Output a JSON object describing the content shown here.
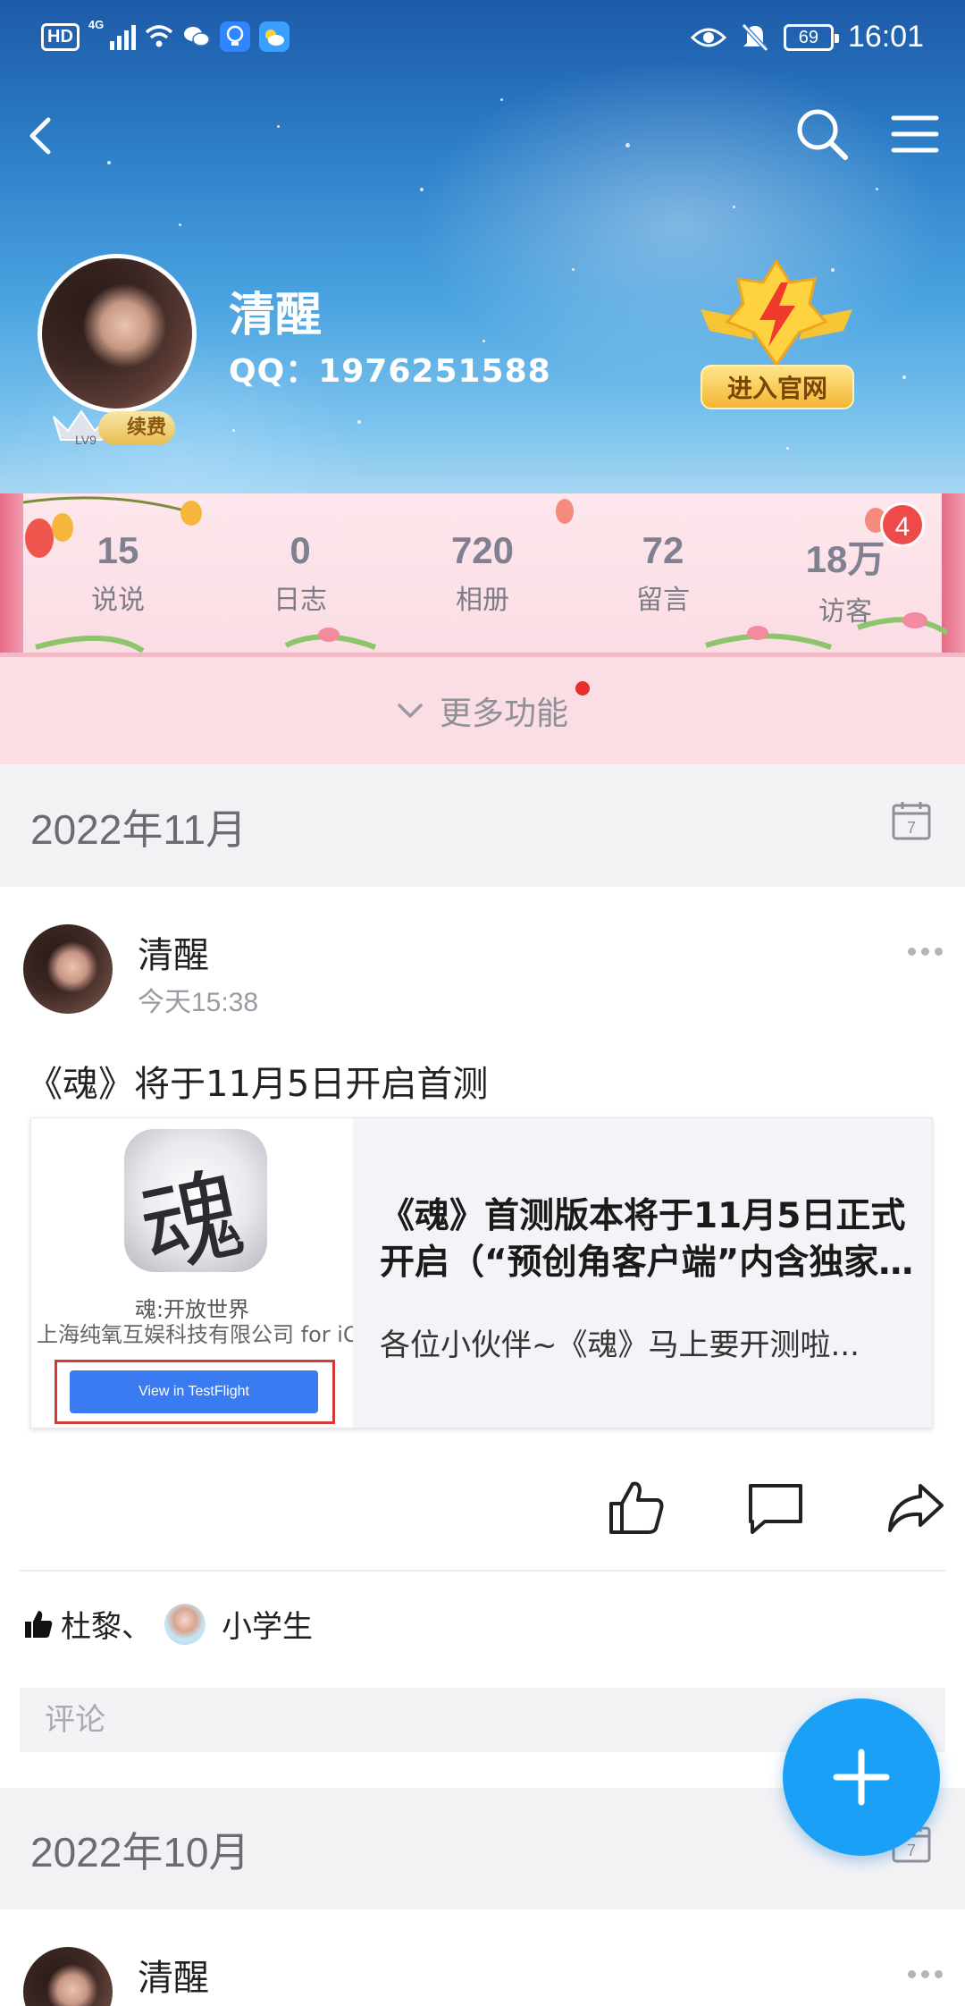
{
  "status_bar": {
    "hd": "HD",
    "network": "4G",
    "battery": "69",
    "time": "16:01"
  },
  "colors": {
    "accent": "#1aa1f7",
    "badge_red": "#ef4a4a",
    "pink_band": "#fbdde4"
  },
  "nav": {
    "back_icon": "back-arrow-icon",
    "search_icon": "search-icon",
    "menu_icon": "menu-icon"
  },
  "profile": {
    "name": "清醒",
    "qq": "QQ：1976251588",
    "vip_level": "LV9",
    "vip_action": "续费",
    "official_site": "进入官网"
  },
  "stats": [
    {
      "value": "15",
      "label": "说说"
    },
    {
      "value": "0",
      "label": "日志"
    },
    {
      "value": "720",
      "label": "相册"
    },
    {
      "value": "72",
      "label": "留言"
    },
    {
      "value": "18万",
      "label": "访客"
    }
  ],
  "visitor_badge": "4",
  "more": {
    "label": "更多功能"
  },
  "sections": [
    {
      "date": "2022年11月"
    },
    {
      "date": "2022年10月"
    }
  ],
  "calendar_day": "7",
  "post": {
    "author": "清醒",
    "time": "今天15:38",
    "text": "《魂》将于11月5日开启首测",
    "share": {
      "thumb_app": "魂",
      "thumb_title": "魂:开放世界",
      "thumb_sub": "上海纯氧互娱科技有限公司 for iOS",
      "thumb_button": "View in TestFlight",
      "title": "《魂》首测版本将于11月5日正式开启（“预创角客户端”内含独家福利）",
      "desc": "各位小伙伴~《魂》马上要开测啦..."
    },
    "likes": {
      "names": "杜黎、",
      "name2": "小学生"
    },
    "comment_placeholder": "评论"
  },
  "post2": {
    "author": "清醒"
  }
}
